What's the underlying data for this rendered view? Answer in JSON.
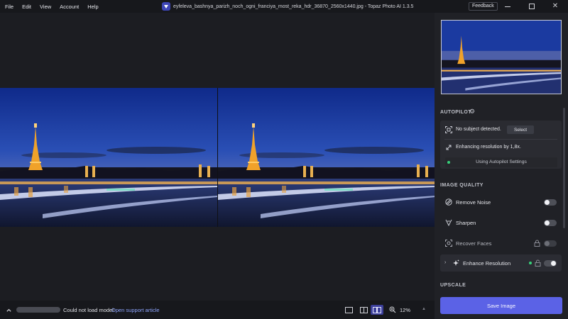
{
  "menu": [
    "File",
    "Edit",
    "View",
    "Account",
    "Help"
  ],
  "window": {
    "title": "eyfeleva_bashnya_parizh_noch_ogni_franciya_most_reka_hdr_36870_2560x1440.jpg - Topaz Photo AI 1.3.5",
    "feedback_label": "Feedback",
    "controls": [
      "minimize-icon",
      "maximize-icon",
      "close-icon"
    ]
  },
  "bottom_bar": {
    "status": "Could not load model",
    "support_link": "Open support article",
    "zoom": "12%",
    "view_modes": [
      "single-view-icon",
      "split-view-icon",
      "side-by-side-view-icon"
    ],
    "active_view": "side-by-side"
  },
  "panel": {
    "autopilot_title": "AUTOPILOT",
    "no_subject": "No subject detected.",
    "select_label": "Select",
    "enhancing": "Enhancing resolution by 1,8x.",
    "autopilot_settings": "Using Autopilot Settings",
    "image_quality_title": "IMAGE QUALITY",
    "features": [
      {
        "label": "Remove Noise",
        "icon": "noise-icon",
        "enabled": false,
        "locked": false
      },
      {
        "label": "Sharpen",
        "icon": "sharpen-icon",
        "enabled": false,
        "locked": false
      },
      {
        "label": "Recover Faces",
        "icon": "face-scan-icon",
        "enabled": false,
        "locked": true
      },
      {
        "label": "Enhance Resolution",
        "icon": "sparkle-icon",
        "enabled": true,
        "locked": true
      }
    ],
    "upscale_title": "UPSCALE",
    "save_label": "Save Image"
  },
  "colors": {
    "accent": "#5b62e6",
    "status_dot": "#37d17a",
    "link": "#8fa6ff"
  }
}
